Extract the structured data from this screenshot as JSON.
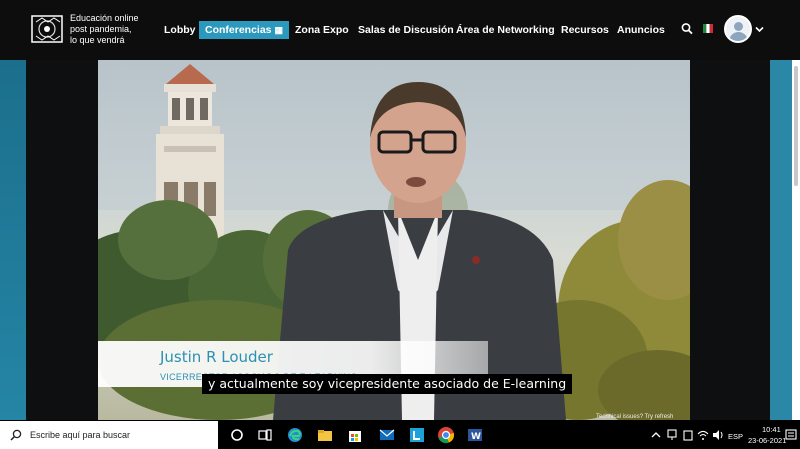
{
  "header": {
    "logo_lines": [
      "Educación online",
      "post pandemia,",
      "lo que vendrá"
    ],
    "nav": [
      {
        "label": "Lobby"
      },
      {
        "label": "Conferencias",
        "active": true
      },
      {
        "label": "Zona Expo"
      },
      {
        "label": "Salas de Discusión"
      },
      {
        "label": "Área de Networking"
      },
      {
        "label": "Recursos"
      },
      {
        "label": "Anuncios"
      }
    ],
    "accent_color": "#2b98bd"
  },
  "video": {
    "speaker_name": "Justin R Louder",
    "speaker_role": "VICERRECTOR ASOCIADO DE E-LEARNING",
    "subtitle": "y actualmente soy vicepresidente asociado de E-learning",
    "tech_issues": "Technical issues? Try refresh"
  },
  "taskbar": {
    "search_placeholder": "Escribe aquí para buscar",
    "language": "ESP",
    "time": "10:41",
    "date": "23-06-2021",
    "apps": [
      "task-view-icon",
      "edge-icon",
      "file-explorer-icon",
      "store-icon",
      "mail-icon",
      "lens-icon",
      "chrome-icon",
      "word-icon"
    ]
  }
}
